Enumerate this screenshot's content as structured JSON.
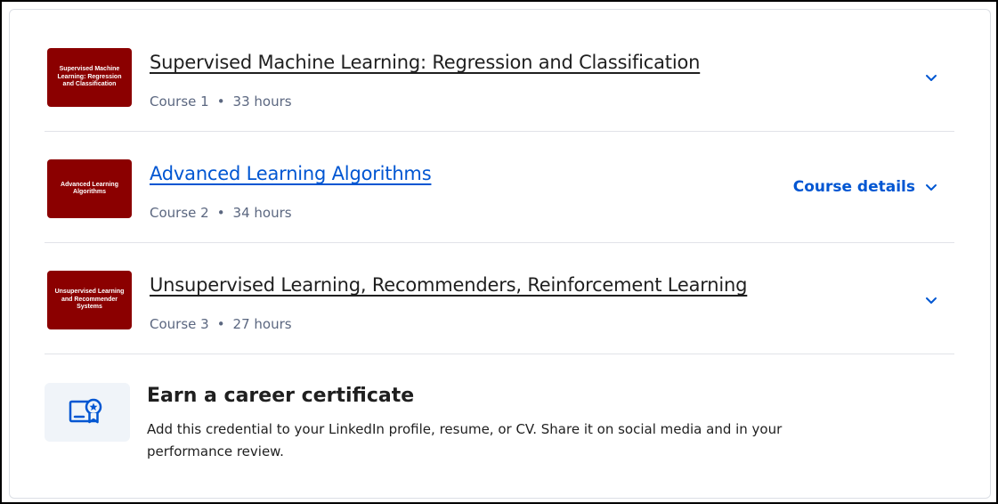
{
  "courses": [
    {
      "thumbnail_text": "Supervised Machine Learning: Regression and Classification",
      "title": "Supervised Machine Learning: Regression and Classification",
      "course_label": "Course 1",
      "separator": "•",
      "duration": "33 hours",
      "expand_icon": "chevron-down-icon"
    },
    {
      "thumbnail_text": "Advanced Learning Algorithms",
      "title": "Advanced Learning Algorithms",
      "course_label": "Course 2",
      "separator": "•",
      "duration": "34 hours",
      "details_label": "Course details",
      "expand_icon": "chevron-down-icon"
    },
    {
      "thumbnail_text": "Unsupervised Learning and Recommender Systems",
      "title": "Unsupervised Learning, Recommenders, Reinforcement Learning",
      "course_label": "Course 3",
      "separator": "•",
      "duration": "27 hours",
      "expand_icon": "chevron-down-icon"
    }
  ],
  "certificate": {
    "icon": "certificate-icon",
    "heading": "Earn a career certificate",
    "description": "Add this credential to your LinkedIn profile, resume, or CV. Share it on social media and in your performance review."
  },
  "colors": {
    "thumbnail_bg": "#8b0000",
    "link_active": "#0056d2",
    "meta_text": "#5b6780",
    "divider": "#e1e3e8"
  }
}
